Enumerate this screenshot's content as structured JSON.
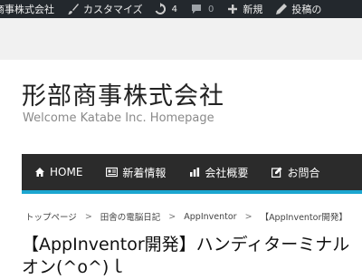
{
  "admin_bar": {
    "site_name": "商事株式会社",
    "customize_label": "カスタマイズ",
    "updates_count": "4",
    "comments_count": "0",
    "new_label": "新規",
    "edit_post_label": "投稿の"
  },
  "site": {
    "title": "形部商事株式会社",
    "tagline": "Welcome Katabe Inc. Homepage"
  },
  "nav": {
    "items": [
      {
        "label": "HOME",
        "icon": "home-icon"
      },
      {
        "label": "新着情報",
        "icon": "news-icon"
      },
      {
        "label": "会社概要",
        "icon": "chart-icon"
      },
      {
        "label": "お問合",
        "icon": "edit-icon"
      }
    ],
    "bar_color": "#2b2b2b",
    "accent_color": "#1ba6d0"
  },
  "breadcrumb": {
    "items": [
      "トップページ",
      "田舎の電脳日記",
      "AppInventor",
      "【AppInventor開発】"
    ],
    "separator": ">"
  },
  "post": {
    "title_line1": "【AppInventor開発】ハンディターミナル",
    "title_line2": "オン(^o^)ｌ"
  }
}
